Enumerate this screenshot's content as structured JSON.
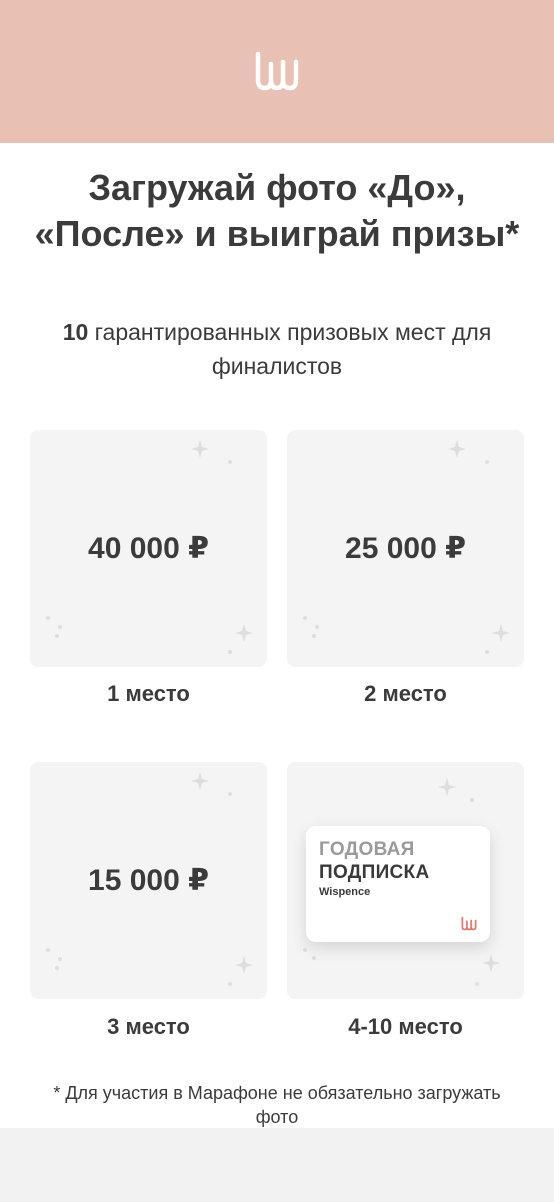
{
  "header": {
    "logo_icon": "wispence-logo-icon",
    "bg_color": "#e8c1b4"
  },
  "hero": {
    "title": "Загружай фото «До», «После» и выиграй призы*",
    "subtitle_count": "10",
    "subtitle_text": " гарантированных призовых мест для финалистов"
  },
  "prizes": [
    {
      "amount": "40 000 ₽",
      "place": "1 место"
    },
    {
      "amount": "25 000 ₽",
      "place": "2 место"
    },
    {
      "amount": "15 000 ₽",
      "place": "3 место"
    },
    {
      "place": "4-10 место",
      "subscription": {
        "line1": "ГОДОВАЯ",
        "line2": "ПОДПИСКА",
        "brand": "Wispence"
      }
    }
  ],
  "footnote": "* Для участия в Марафоне не обязательно загружать фото",
  "colors": {
    "accent": "#e8c1b4",
    "logo_accent": "#e27a6a",
    "text": "#3b3b3b"
  }
}
